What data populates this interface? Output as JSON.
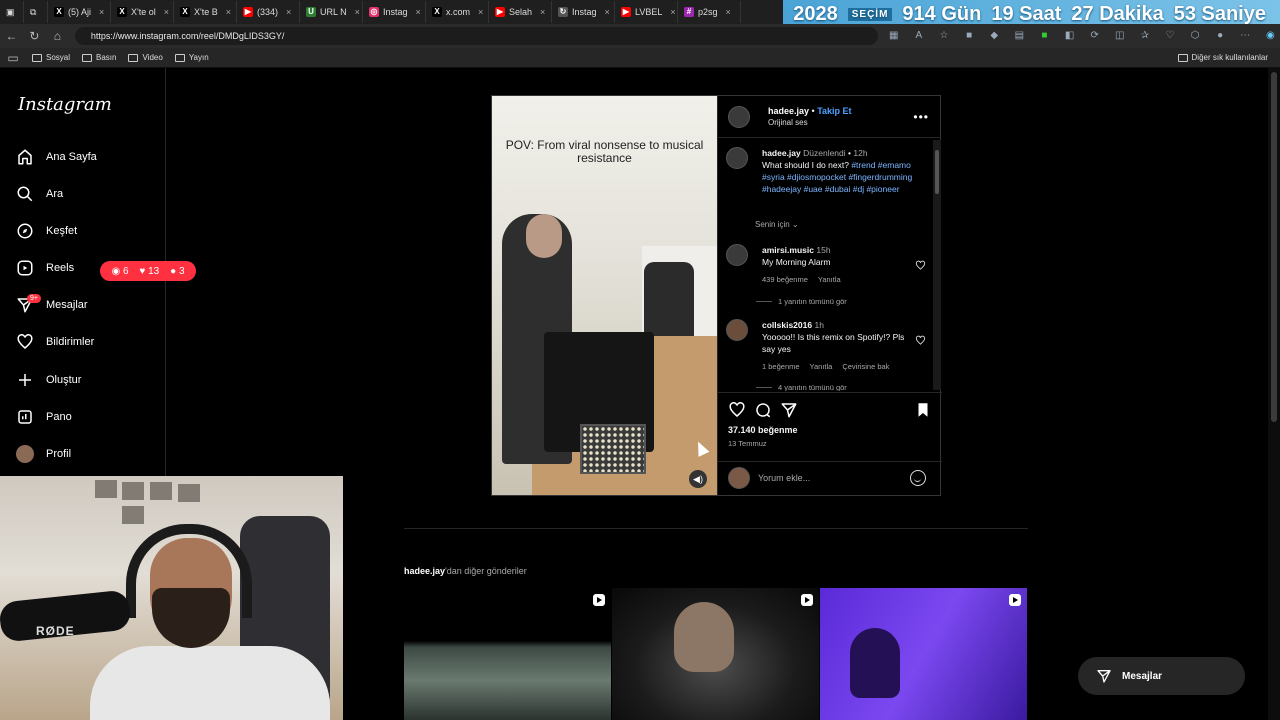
{
  "browser": {
    "tabs": [
      {
        "label": "(5) Aji",
        "color": "#000000",
        "glyph": "X"
      },
      {
        "label": "X'te ol",
        "color": "#000000",
        "glyph": "X"
      },
      {
        "label": "X'te B",
        "color": "#000000",
        "glyph": "X"
      },
      {
        "label": "(334)",
        "color": "#ff0000",
        "glyph": "▶"
      },
      {
        "label": "URL N",
        "color": "#2e7d32",
        "glyph": "U"
      },
      {
        "label": "Instag",
        "color": "#e1306c",
        "glyph": "◎"
      },
      {
        "label": "x.com",
        "color": "#000000",
        "glyph": "X"
      },
      {
        "label": "Selah",
        "color": "#ff0000",
        "glyph": "▶"
      },
      {
        "label": "Instag",
        "color": "#555555",
        "glyph": "↻"
      },
      {
        "label": "LVBEL",
        "color": "#ff0000",
        "glyph": "▶"
      },
      {
        "label": "p2sg",
        "color": "#9c27b0",
        "glyph": "#"
      }
    ],
    "url": "https://www.instagram.com/reel/DMDgLIDS3GY/",
    "bookmarks": [
      "Sosyal",
      "Basın",
      "Video",
      "Yayın"
    ],
    "bookmarks_other": "Diğer sık kullanılanlar"
  },
  "countdown": {
    "year": "2028",
    "tag": "SEÇİM",
    "days": "914 Gün",
    "hours": "19 Saat",
    "minutes": "27 Dakika",
    "seconds": "53 Saniye"
  },
  "sidebar": {
    "logo": "Instagram",
    "items": [
      {
        "label": "Ana Sayfa",
        "icon": "home-icon"
      },
      {
        "label": "Ara",
        "icon": "search-icon"
      },
      {
        "label": "Keşfet",
        "icon": "compass-icon"
      },
      {
        "label": "Reels",
        "icon": "reels-icon"
      },
      {
        "label": "Mesajlar",
        "icon": "send-icon"
      },
      {
        "label": "Bildirimler",
        "icon": "heart-icon"
      },
      {
        "label": "Oluştur",
        "icon": "plus-icon"
      },
      {
        "label": "Pano",
        "icon": "dashboard-icon"
      },
      {
        "label": "Profil",
        "icon": "avatar-icon"
      }
    ],
    "messages_badge": "9+",
    "notifications": {
      "comments": "6",
      "likes": "13",
      "follows": "3"
    }
  },
  "webcam": {
    "mic_brand": "RØDE"
  },
  "post": {
    "video_caption": "POV: From viral nonsense to musical resistance",
    "username": "hadee.jay",
    "follow": "Takip Et",
    "audio": "Orijinal ses",
    "caption": {
      "user": "hadee.jay",
      "edited": "Düzenlendi",
      "time": "12h",
      "text": "What should I do next?",
      "tags": "#trend #emamo #syria #djiosmopocket #fingerdrumming #hadeejay #uae #dubai #dj #pioneer"
    },
    "for_you": "Senin için",
    "comments": [
      {
        "user": "amirsi.music",
        "time": "15h",
        "text": "My Morning Alarm",
        "likes": "439 beğenme",
        "reply": "Yanıtla",
        "translate": "",
        "replies": "1 yanıtın tümünü gör"
      },
      {
        "user": "collskis2016",
        "time": "1h",
        "text": "Yooooo!! Is this remix on Spotify!? Pls say yes",
        "likes": "1 beğenme",
        "reply": "Yanıtla",
        "translate": "Çevirisine bak",
        "replies": "4 yanıtın tümünü gör"
      }
    ],
    "like_count": "37.140 beğenme",
    "date": "13 Temmuz",
    "comment_placeholder": "Yorum ekle..."
  },
  "more": {
    "user": "hadee.jay",
    "suffix": "'dan diğer gönderiler"
  },
  "messages_button": "Mesajlar",
  "colors": {
    "accent_blue": "#4da3ff",
    "notification_red": "#ff3040"
  }
}
